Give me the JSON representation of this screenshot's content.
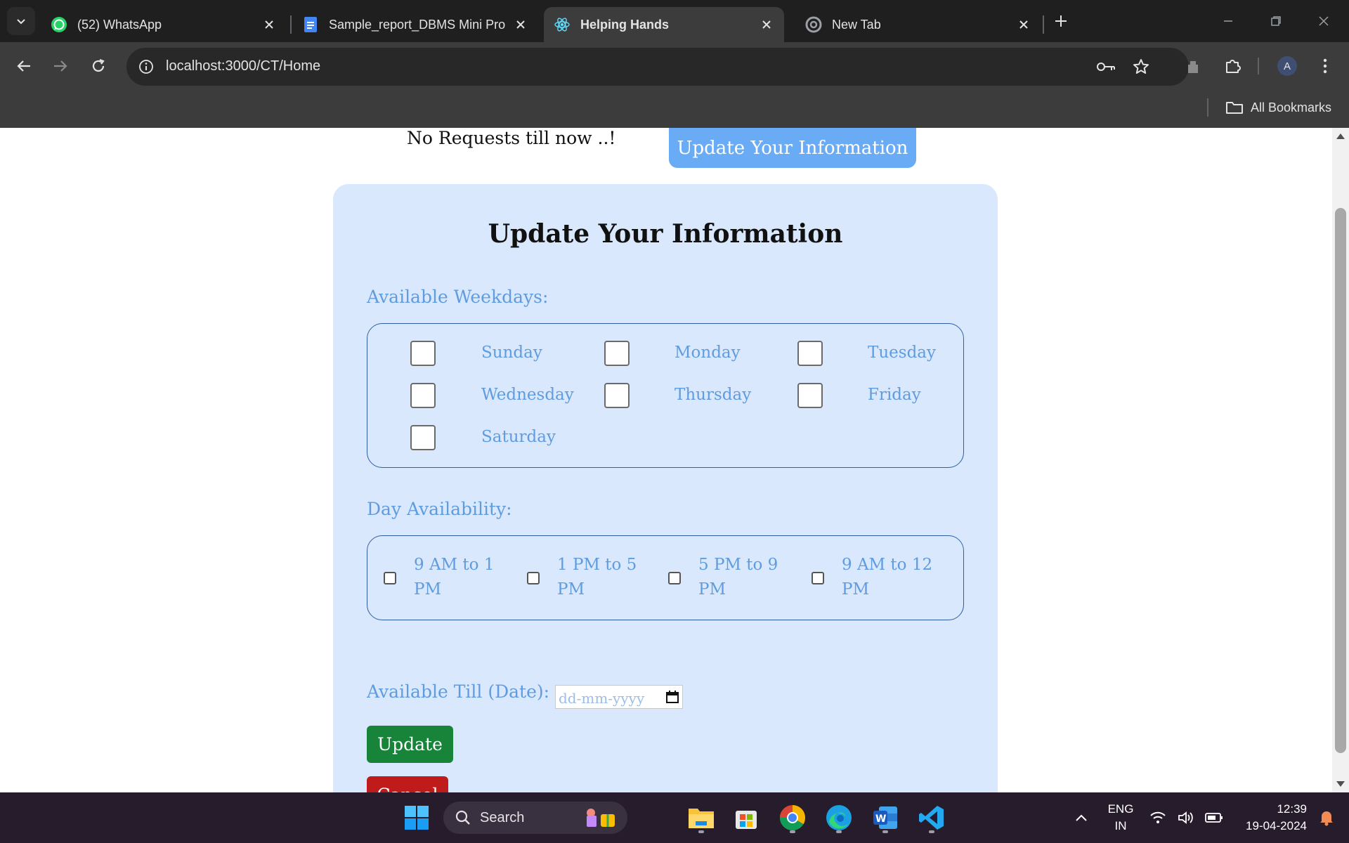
{
  "browser": {
    "tabs": [
      {
        "title": "(52) WhatsApp",
        "active": false,
        "icon": "whatsapp-icon"
      },
      {
        "title": "Sample_report_DBMS Mini Pro",
        "active": false,
        "icon": "docs-icon"
      },
      {
        "title": "Helping Hands",
        "active": true,
        "icon": "react-icon"
      },
      {
        "title": "New Tab",
        "active": false,
        "icon": "chrome-icon"
      }
    ],
    "url": "localhost:3000/CT/Home",
    "profile_initial": "A",
    "bookmarks_label": "All Bookmarks"
  },
  "page": {
    "no_requests_text": "No Requests till now ..!",
    "top_button_label": "Update Your Information",
    "form": {
      "title": "Update Your Information",
      "weekdays_label": "Available Weekdays:",
      "weekdays": [
        "Sunday",
        "Monday",
        "Tuesday",
        "Wednesday",
        "Thursday",
        "Friday",
        "Saturday"
      ],
      "day_availability_label": "Day Availability:",
      "slots": [
        "9 AM to 1 PM",
        "1 PM to 5 PM",
        "5 PM to 9 PM",
        "9 AM to 12 PM"
      ],
      "available_till_label": "Available Till (Date):",
      "date_placeholder": "dd-mm-yyyy",
      "update_label": "Update",
      "cancel_label": "Cancel"
    }
  },
  "taskbar": {
    "search_label": "Search",
    "language": "ENG",
    "region": "IN",
    "time": "12:39",
    "date": "19-04-2024"
  },
  "colors": {
    "accent_blue": "#6aabf5",
    "card_bg": "#d9e8fc",
    "label_blue": "#5f9cdf",
    "update_green": "#17843a",
    "cancel_red": "#bf1b1b"
  }
}
